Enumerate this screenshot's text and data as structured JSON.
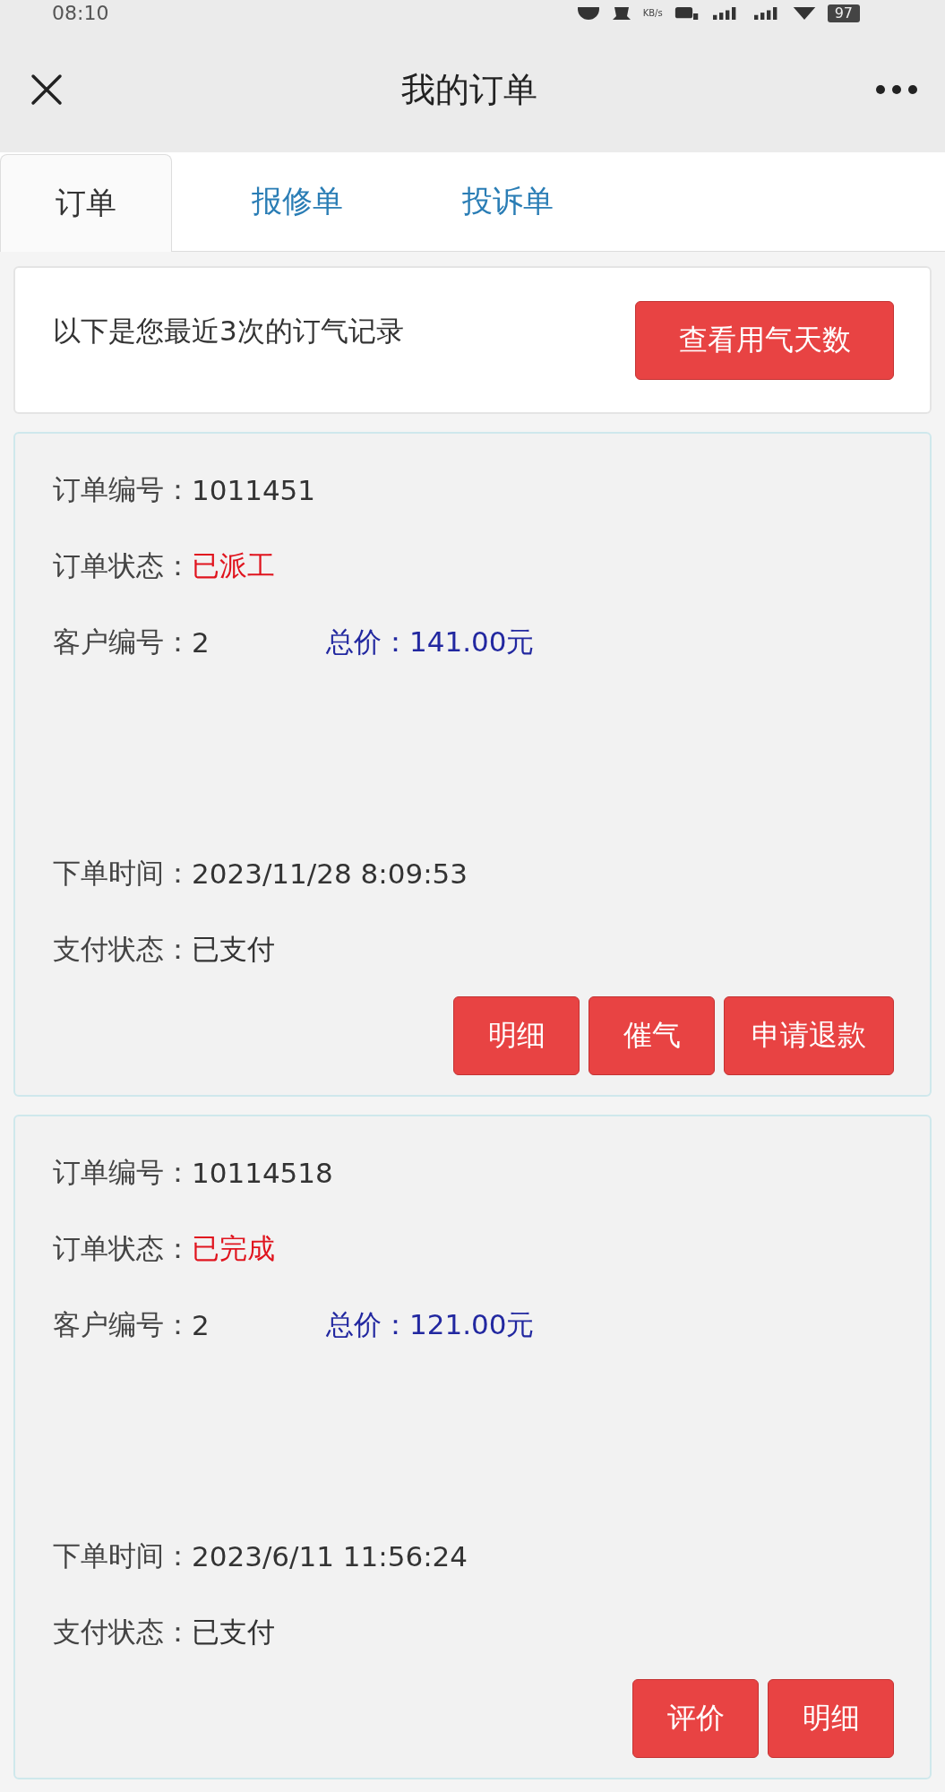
{
  "status_bar": {
    "time": "08:10",
    "speed": "KB/s",
    "battery": "97"
  },
  "nav": {
    "title": "我的订单"
  },
  "tabs": [
    {
      "label": "订单",
      "selected": true
    },
    {
      "label": "报修单",
      "selected": false
    },
    {
      "label": "投诉单",
      "selected": false
    }
  ],
  "notice": {
    "text": "以下是您最近3次的订气记录",
    "button": "查看用气天数"
  },
  "orders": [
    {
      "number_label": "订单编号：",
      "number": "1011451",
      "status_label": "订单状态：",
      "status": "已派工",
      "customer_label": "客户编号：",
      "customer": "2",
      "price_label": "总价：",
      "price": "141.00元",
      "time_label": "下单时间：",
      "time": "2023/11/28 8:09:53",
      "pay_label": "支付状态：",
      "pay": "已支付",
      "buttons": [
        "明细",
        "催气",
        "申请退款"
      ]
    },
    {
      "number_label": "订单编号：",
      "number": "10114518",
      "status_label": "订单状态：",
      "status": "已完成",
      "customer_label": "客户编号：",
      "customer": "2",
      "price_label": "总价：",
      "price": "121.00元",
      "time_label": "下单时间：",
      "time": "2023/6/11 11:56:24",
      "pay_label": "支付状态：",
      "pay": "已支付",
      "buttons": [
        "评价",
        "明细"
      ]
    }
  ]
}
